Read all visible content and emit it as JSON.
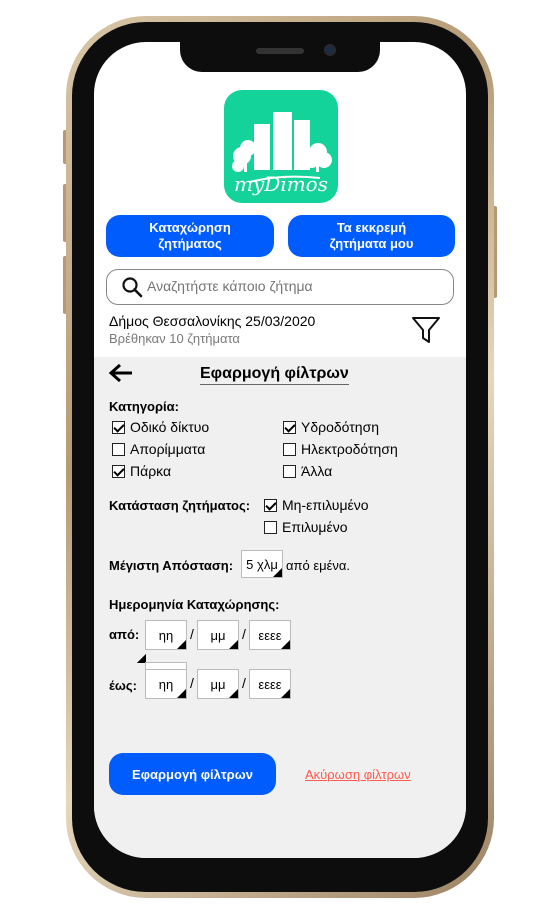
{
  "app": {
    "logo_text": "myDimos",
    "brand_color": "#13d29a",
    "accent_color": "#005cfd"
  },
  "top_buttons": {
    "register_line1": "Καταχώρηση",
    "register_line2": "ζητήματος",
    "pending_line1": "Τα εκκρεμή",
    "pending_line2": "ζητήματα μου"
  },
  "search": {
    "placeholder": "Αναζητήστε κάποιο ζήτημα",
    "icon": "search-icon"
  },
  "info": {
    "title": "Δήμος Θεσσαλονίκης 25/03/2020",
    "subtitle": "Βρέθηκαν 10 ζητήματα",
    "filter_icon": "filter-icon"
  },
  "filters": {
    "title": "Εφαρμογή φίλτρων",
    "category_label": "Κατηγορία:",
    "categories": [
      {
        "label": "Οδικό δίκτυο",
        "checked": true
      },
      {
        "label": "Απορίμματα",
        "checked": false
      },
      {
        "label": "Πάρκα",
        "checked": true
      },
      {
        "label": "Υδροδότηση",
        "checked": true
      },
      {
        "label": "Ηλεκτροδότηση",
        "checked": false
      },
      {
        "label": "Άλλα",
        "checked": false
      }
    ],
    "status_label": "Κατάσταση ζητήματος:",
    "statuses": [
      {
        "label": "Μη-επιλυμένο",
        "checked": true
      },
      {
        "label": "Επιλυμένο",
        "checked": false
      }
    ],
    "distance_label": "Μέγιστη Απόσταση:",
    "distance_value": "5 χλμ",
    "distance_suffix": "από εμένα.",
    "date_label": "Ημερομηνία Καταχώρησης:",
    "from_label": "από:",
    "to_label": "έως:",
    "day_placeholder": "ηη",
    "month_placeholder": "μμ",
    "year_placeholder": "εεεε",
    "separator": "/",
    "apply_button": "Εφαρμογή φίλτρων",
    "cancel_link": "Ακύρωση φίλτρων"
  }
}
